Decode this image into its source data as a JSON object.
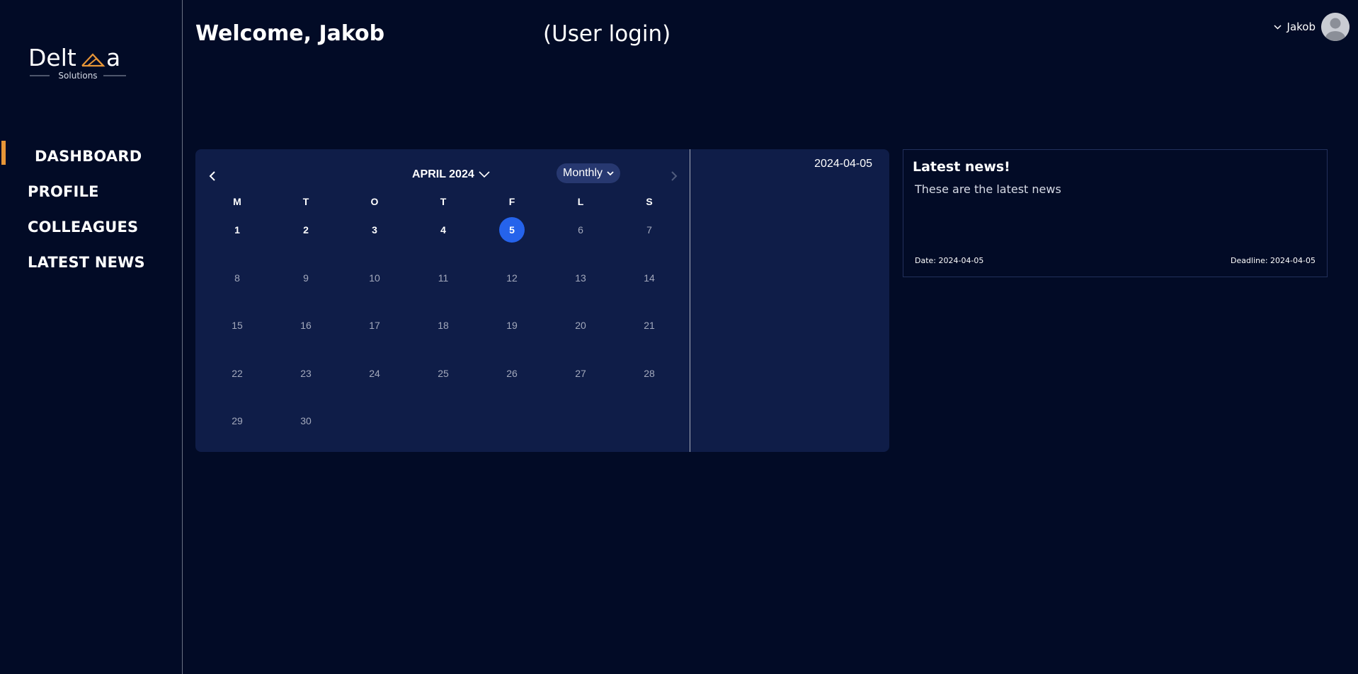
{
  "brand": {
    "logo_text": "Deltma",
    "logo_sub": "Solutions",
    "accent": "#e89637"
  },
  "sidebar": {
    "items": [
      {
        "label": "DASHBOARD",
        "active": true
      },
      {
        "label": "PROFILE",
        "active": false
      },
      {
        "label": "COLLEAGUES",
        "active": false
      },
      {
        "label": "LATEST NEWS",
        "active": false
      }
    ]
  },
  "header": {
    "welcome": "Welcome, Jakob",
    "user_login": "(User login)",
    "user_name": "Jakob",
    "avatar_icon": "user-avatar-icon"
  },
  "calendar": {
    "month_label": "APRIL 2024",
    "view_option": "Monthly",
    "weekdays": [
      "M",
      "T",
      "O",
      "T",
      "F",
      "L",
      "S"
    ],
    "weeks": [
      [
        "1",
        "2",
        "3",
        "4",
        "5",
        "6",
        "7"
      ],
      [
        "8",
        "9",
        "10",
        "11",
        "12",
        "13",
        "14"
      ],
      [
        "15",
        "16",
        "17",
        "18",
        "19",
        "20",
        "21"
      ],
      [
        "22",
        "23",
        "24",
        "25",
        "26",
        "27",
        "28"
      ],
      [
        "29",
        "30",
        "",
        "",
        "",
        "",
        ""
      ]
    ],
    "bold_days": [
      "1",
      "2",
      "3",
      "4"
    ],
    "selected_day": "5",
    "selected_color": "#2563eb",
    "side_date": "2024-04-05"
  },
  "news": {
    "title": "Latest news!",
    "body": "These are the latest news",
    "date": "Date: 2024-04-05",
    "deadline": "Deadline: 2024-04-05"
  }
}
